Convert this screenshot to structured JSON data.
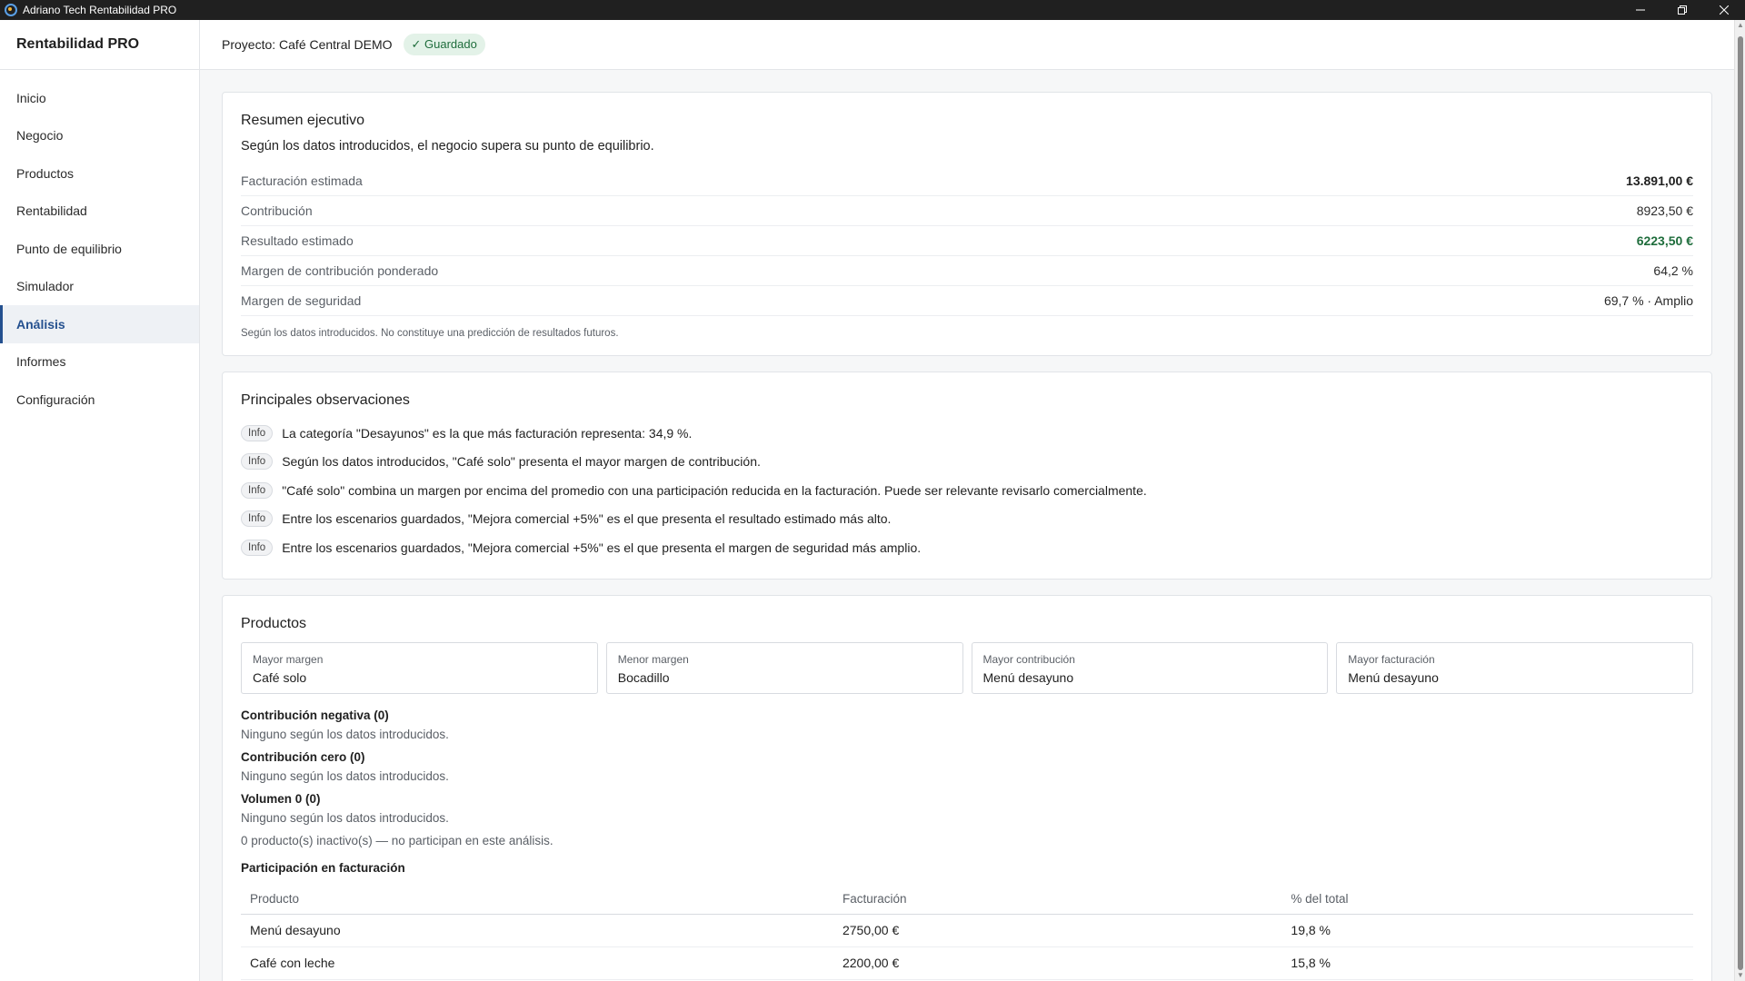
{
  "window": {
    "title": "Adriano Tech Rentabilidad PRO",
    "minimize_icon": "minimize-icon",
    "restore_icon": "restore-icon",
    "close_icon": "close-icon"
  },
  "sidebar": {
    "brand": "Rentabilidad PRO",
    "items": [
      {
        "label": "Inicio",
        "active": false
      },
      {
        "label": "Negocio",
        "active": false
      },
      {
        "label": "Productos",
        "active": false
      },
      {
        "label": "Rentabilidad",
        "active": false
      },
      {
        "label": "Punto de equilibrio",
        "active": false
      },
      {
        "label": "Simulador",
        "active": false
      },
      {
        "label": "Análisis",
        "active": true
      },
      {
        "label": "Informes",
        "active": false
      },
      {
        "label": "Configuración",
        "active": false
      }
    ]
  },
  "header": {
    "project": "Proyecto: Café Central DEMO",
    "saved_badge": "✓ Guardado"
  },
  "summary": {
    "title": "Resumen ejecutivo",
    "intro": "Según los datos introducidos, el negocio supera su punto de equilibrio.",
    "rows": [
      {
        "label": "Facturación estimada",
        "value": "13.891,00 €"
      },
      {
        "label": "Contribución",
        "value": "8923,50 €"
      },
      {
        "label": "Resultado estimado",
        "value": "6223,50 €"
      },
      {
        "label": "Margen de contribución ponderado",
        "value": "64,2 %"
      },
      {
        "label": "Margen de seguridad",
        "value": "69,7 % · Amplio"
      }
    ],
    "disclaimer": "Según los datos introducidos. No constituye una predicción de resultados futuros."
  },
  "observations": {
    "title": "Principales observaciones",
    "items": [
      {
        "tag": "Info",
        "text": "La categoría \"Desayunos\" es la que más facturación representa: 34,9 %."
      },
      {
        "tag": "Info",
        "text": "Según los datos introducidos, \"Café solo\" presenta el mayor margen de contribución."
      },
      {
        "tag": "Info",
        "text": "\"Café solo\" combina un margen por encima del promedio con una participación reducida en la facturación. Puede ser relevante revisarlo comercialmente."
      },
      {
        "tag": "Info",
        "text": "Entre los escenarios guardados, \"Mejora comercial +5%\" es el que presenta el resultado estimado más alto."
      },
      {
        "tag": "Info",
        "text": "Entre los escenarios guardados, \"Mejora comercial +5%\" es el que presenta el margen de seguridad más amplio."
      }
    ]
  },
  "products": {
    "title": "Productos",
    "metrics": [
      {
        "label": "Mayor margen",
        "value": "Café solo"
      },
      {
        "label": "Menor margen",
        "value": "Bocadillo"
      },
      {
        "label": "Mayor contribución",
        "value": "Menú desayuno"
      },
      {
        "label": "Mayor facturación",
        "value": "Menú desayuno"
      }
    ],
    "groups": [
      {
        "heading": "Contribución negativa (0)",
        "text": "Ninguno según los datos introducidos."
      },
      {
        "heading": "Contribución cero (0)",
        "text": "Ninguno según los datos introducidos."
      },
      {
        "heading": "Volumen 0 (0)",
        "text": "Ninguno según los datos introducidos."
      }
    ],
    "inactive": "0 producto(s) inactivo(s) — no participan en este análisis.",
    "share_title": "Participación en facturación",
    "share_table": {
      "headers": [
        "Producto",
        "Facturación",
        "% del total"
      ],
      "rows": [
        [
          "Menú desayuno",
          "2750,00 €",
          "19,8 %"
        ],
        [
          "Café con leche",
          "2200,00 €",
          "15,8 %"
        ]
      ]
    }
  }
}
